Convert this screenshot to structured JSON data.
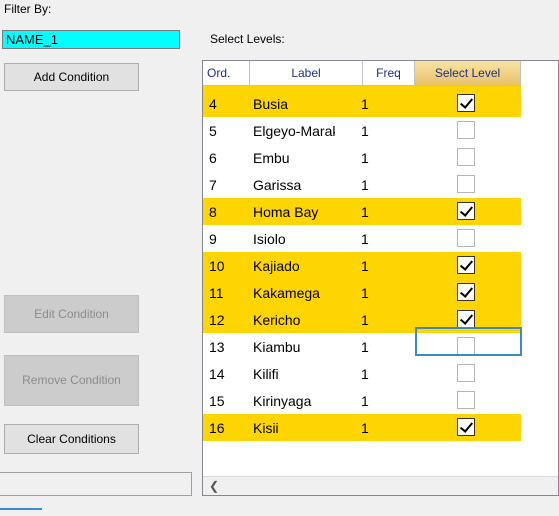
{
  "filter": {
    "label": "Filter By:",
    "value": "NAME_1",
    "highlight_color": "#00ffff"
  },
  "buttons": {
    "add_condition": "Add Condition",
    "edit_condition": "Edit Condition",
    "remove_condition": "Remove Condition",
    "clear_conditions": "Clear Conditions"
  },
  "levels": {
    "label": "Select Levels:",
    "headers": [
      "Ord.",
      "Label",
      "Freq",
      "Select Level"
    ],
    "selected_row_color": "#ffd500",
    "rows": [
      {
        "ord": "4",
        "label": "Busia",
        "freq": "1",
        "selected": true
      },
      {
        "ord": "5",
        "label": "Elgeyo-Marakwet",
        "freq": "1",
        "selected": false
      },
      {
        "ord": "6",
        "label": "Embu",
        "freq": "1",
        "selected": false
      },
      {
        "ord": "7",
        "label": "Garissa",
        "freq": "1",
        "selected": false
      },
      {
        "ord": "8",
        "label": "Homa Bay",
        "freq": "1",
        "selected": true
      },
      {
        "ord": "9",
        "label": "Isiolo",
        "freq": "1",
        "selected": false
      },
      {
        "ord": "10",
        "label": "Kajiado",
        "freq": "1",
        "selected": true
      },
      {
        "ord": "11",
        "label": "Kakamega",
        "freq": "1",
        "selected": true
      },
      {
        "ord": "12",
        "label": "Kericho",
        "freq": "1",
        "selected": true
      },
      {
        "ord": "13",
        "label": "Kiambu",
        "freq": "1",
        "selected": false
      },
      {
        "ord": "14",
        "label": "Kilifi",
        "freq": "1",
        "selected": false
      },
      {
        "ord": "15",
        "label": "Kirinyaga",
        "freq": "1",
        "selected": false
      },
      {
        "ord": "16",
        "label": "Kisii",
        "freq": "1",
        "selected": true
      }
    ]
  },
  "scroll_left_icon": "chevron-left-icon"
}
